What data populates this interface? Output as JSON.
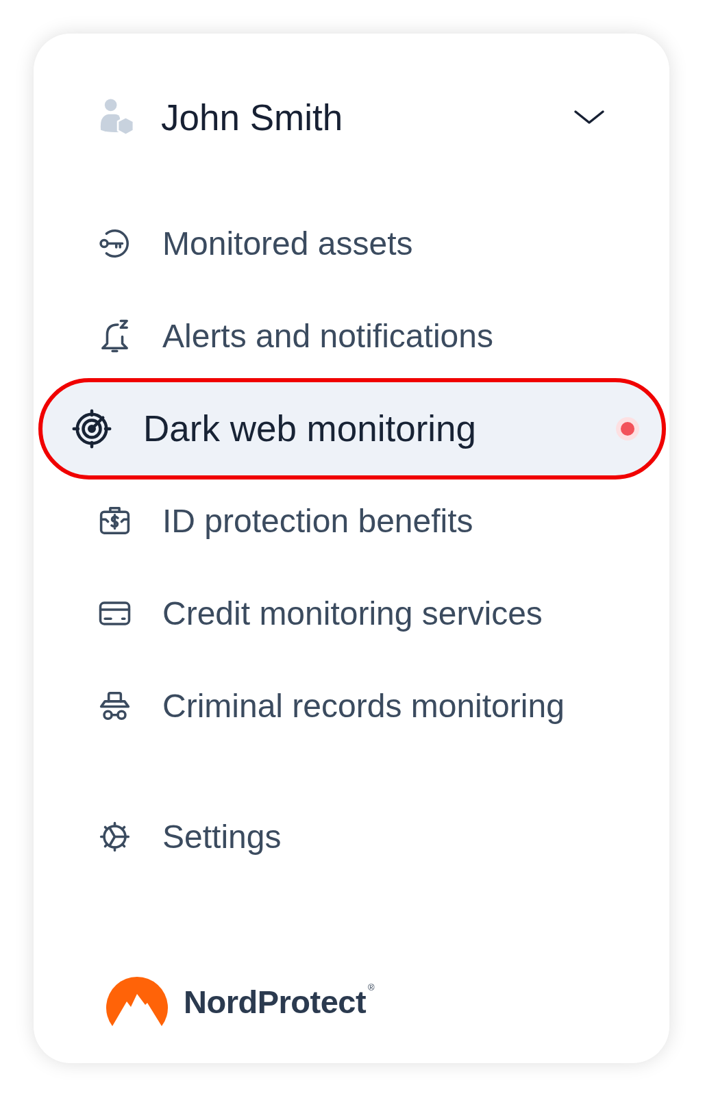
{
  "user": {
    "name": "John Smith",
    "expanded": false
  },
  "menu_items": [
    {
      "label": "Monitored assets",
      "selected": false,
      "alert": false
    },
    {
      "label": "Alerts and notifications",
      "selected": false,
      "alert": false
    },
    {
      "label": "Dark web monitoring",
      "selected": true,
      "alert": true
    },
    {
      "label": "ID protection benefits",
      "selected": false,
      "alert": false
    },
    {
      "label": "Credit monitoring services",
      "selected": false,
      "alert": false
    },
    {
      "label": "Criminal records monitoring",
      "selected": false,
      "alert": false
    }
  ],
  "bottom_items": [
    {
      "label": "Settings",
      "selected": false,
      "alert": false
    }
  ],
  "logo": {
    "name": "NordProtect",
    "mark": "®"
  }
}
